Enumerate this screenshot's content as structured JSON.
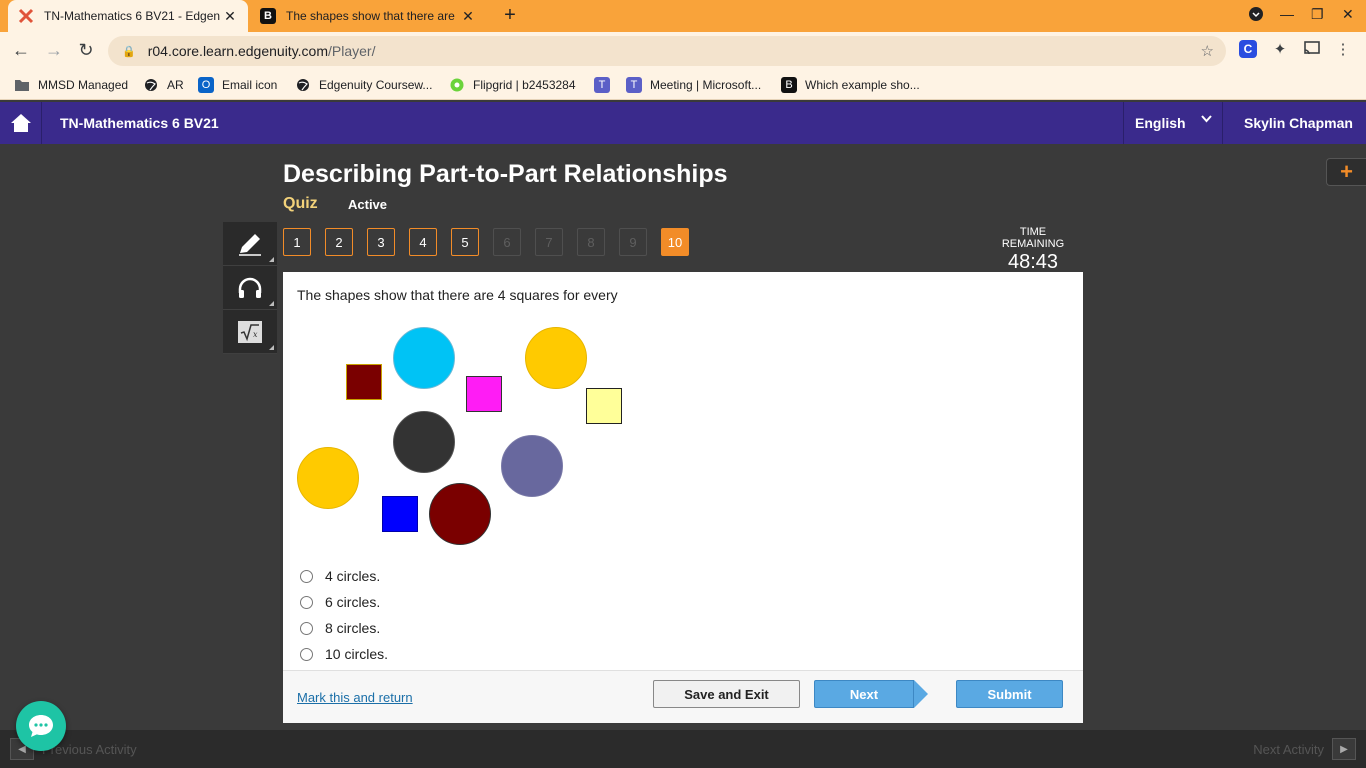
{
  "browser": {
    "tabs": [
      {
        "title": "TN-Mathematics 6 BV21 - Edgen",
        "active": true
      },
      {
        "title": "The shapes show that there are",
        "active": false
      }
    ],
    "url_host": "r04.core.learn.edgenuity.com",
    "url_path": "/Player/",
    "bookmarks": [
      {
        "label": "MMSD Managed",
        "icon": "folder-icon"
      },
      {
        "label": "AR",
        "icon": "globe-icon"
      },
      {
        "label": "Email icon",
        "icon": "outlook-icon"
      },
      {
        "label": "Edgenuity Coursew...",
        "icon": "globe-icon"
      },
      {
        "label": "Flipgrid | b2453284",
        "icon": "flipgrid-icon"
      },
      {
        "label": "",
        "icon": "teams-icon"
      },
      {
        "label": "Meeting | Microsoft...",
        "icon": "teams-icon"
      },
      {
        "label": "Which example sho...",
        "icon": "brainly-icon"
      }
    ]
  },
  "header": {
    "course": "TN-Mathematics 6 BV21",
    "language": "English",
    "user": "Skylin Chapman"
  },
  "lesson": {
    "title": "Describing Part-to-Part Relationships",
    "type": "Quiz",
    "status": "Active"
  },
  "question_nav": [
    {
      "label": "1",
      "state": "answered"
    },
    {
      "label": "2",
      "state": "answered"
    },
    {
      "label": "3",
      "state": "answered"
    },
    {
      "label": "4",
      "state": "answered"
    },
    {
      "label": "5",
      "state": "answered"
    },
    {
      "label": "6",
      "state": "disabled"
    },
    {
      "label": "7",
      "state": "disabled"
    },
    {
      "label": "8",
      "state": "disabled"
    },
    {
      "label": "9",
      "state": "disabled"
    },
    {
      "label": "10",
      "state": "current"
    }
  ],
  "timer": {
    "label": "TIME REMAINING",
    "value": "48:43"
  },
  "question": {
    "prompt": "The shapes show that there are 4 squares for every",
    "options": [
      "4 circles.",
      "6 circles.",
      "8 circles.",
      "10 circles."
    ]
  },
  "footer": {
    "mark_link": "Mark this and return",
    "save_label": "Save and Exit",
    "next_label": "Next",
    "submit_label": "Submit"
  },
  "bottom": {
    "prev_label": "Previous Activity",
    "next_label": "Next Activity"
  },
  "colors": {
    "brand_header": "#3a2a8c",
    "accent_orange": "#f28c28",
    "button_blue": "#5aa9e3",
    "tab_bar": "#f9a33a"
  }
}
